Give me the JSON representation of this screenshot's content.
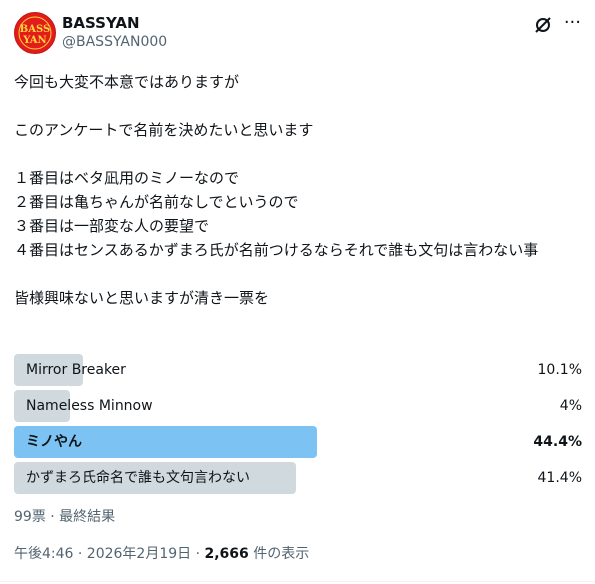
{
  "author": {
    "name": "BASSYAN",
    "handle": "@BASSYAN000",
    "avatar_text": [
      "BASS",
      "YAN"
    ]
  },
  "post": {
    "text": "今回も大変不本意ではありますが\n\nこのアンケートで名前を決めたいと思います\n\n１番目はベタ凪用のミノーなので\n２番目は亀ちゃんが名前なしでというので\n３番目は一部変な人の要望で\n４番目はセンスあるかずまろ氏が名前つけるならそれで誰も文句は言わない事\n\n皆様興味ないと思いますが清き一票を"
  },
  "poll": {
    "options": [
      {
        "label": "Mirror Breaker",
        "percent_text": "10.1%",
        "percent": 10.1,
        "winner": false
      },
      {
        "label": "Nameless Minnow",
        "percent_text": "4%",
        "percent": 4,
        "winner": false
      },
      {
        "label": "ミノやん",
        "percent_text": "44.4%",
        "percent": 44.4,
        "winner": true
      },
      {
        "label": "かずまろ氏命名で誰も文句言わない",
        "percent_text": "41.4%",
        "percent": 41.4,
        "winner": false
      }
    ],
    "summary": "99票 · 最終結果"
  },
  "footer": {
    "timestamp": "午後4:46 · 2026年2月19日 · ",
    "views_count": "2,666",
    "views_label": " 件の表示"
  },
  "colors": {
    "winner_bar": "#7cc3f4",
    "other_bar": "#cfd9de",
    "secondary_text": "#536471"
  },
  "icons": [
    "grok-icon",
    "more-icon"
  ]
}
